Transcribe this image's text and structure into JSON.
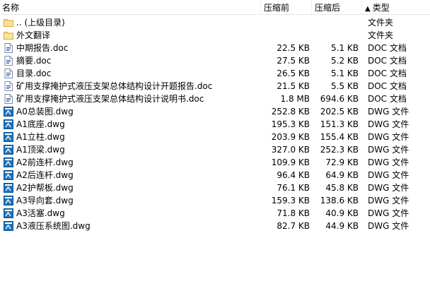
{
  "columns": {
    "name": "名称",
    "compressed": "压缩前",
    "original": "压缩后",
    "type": "类型",
    "sort_indicator": "▲"
  },
  "rows": [
    {
      "name": ".. (上级目录)",
      "compressed": "",
      "original": "",
      "type": "文件夹",
      "icon": "folder-icon"
    },
    {
      "name": "外文翻译",
      "compressed": "",
      "original": "",
      "type": "文件夹",
      "icon": "folder-icon"
    },
    {
      "name": "中期报告.doc",
      "compressed": "22.5 KB",
      "original": "5.1 KB",
      "type": "DOC 文档",
      "icon": "doc-file-icon"
    },
    {
      "name": "摘要.doc",
      "compressed": "27.5 KB",
      "original": "5.2 KB",
      "type": "DOC 文档",
      "icon": "doc-file-icon"
    },
    {
      "name": "目录.doc",
      "compressed": "26.5 KB",
      "original": "5.1 KB",
      "type": "DOC 文档",
      "icon": "doc-file-icon"
    },
    {
      "name": "矿用支撑掩护式液压支架总体结构设计开题报告.doc",
      "compressed": "21.5 KB",
      "original": "5.5 KB",
      "type": "DOC 文档",
      "icon": "doc-file-icon"
    },
    {
      "name": "矿用支撑掩护式液压支架总体结构设计说明书.doc",
      "compressed": "1.8 MB",
      "original": "694.6 KB",
      "type": "DOC 文档",
      "icon": "doc-file-icon"
    },
    {
      "name": "A0总装图.dwg",
      "compressed": "252.8 KB",
      "original": "202.5 KB",
      "type": "DWG 文件",
      "icon": "dwg-file-icon"
    },
    {
      "name": "A1底座.dwg",
      "compressed": "195.3 KB",
      "original": "151.3 KB",
      "type": "DWG 文件",
      "icon": "dwg-file-icon"
    },
    {
      "name": "A1立柱.dwg",
      "compressed": "203.9 KB",
      "original": "155.4 KB",
      "type": "DWG 文件",
      "icon": "dwg-file-icon"
    },
    {
      "name": "A1顶梁.dwg",
      "compressed": "327.0 KB",
      "original": "252.3 KB",
      "type": "DWG 文件",
      "icon": "dwg-file-icon"
    },
    {
      "name": "A2前连杆.dwg",
      "compressed": "109.9 KB",
      "original": "72.9 KB",
      "type": "DWG 文件",
      "icon": "dwg-file-icon"
    },
    {
      "name": "A2后连杆.dwg",
      "compressed": "96.4 KB",
      "original": "64.9 KB",
      "type": "DWG 文件",
      "icon": "dwg-file-icon"
    },
    {
      "name": "A2护帮板.dwg",
      "compressed": "76.1 KB",
      "original": "45.8 KB",
      "type": "DWG 文件",
      "icon": "dwg-file-icon"
    },
    {
      "name": "A3导向套.dwg",
      "compressed": "159.3 KB",
      "original": "138.6 KB",
      "type": "DWG 文件",
      "icon": "dwg-file-icon"
    },
    {
      "name": "A3活塞.dwg",
      "compressed": "71.8 KB",
      "original": "40.9 KB",
      "type": "DWG 文件",
      "icon": "dwg-file-icon"
    },
    {
      "name": "A3液压系统图.dwg",
      "compressed": "82.7 KB",
      "original": "44.9 KB",
      "type": "DWG 文件",
      "icon": "dwg-file-icon"
    }
  ],
  "colors": {
    "folder": "#f5c95a",
    "doc_blue": "#2b5797",
    "dwg_blue": "#1e73be"
  }
}
